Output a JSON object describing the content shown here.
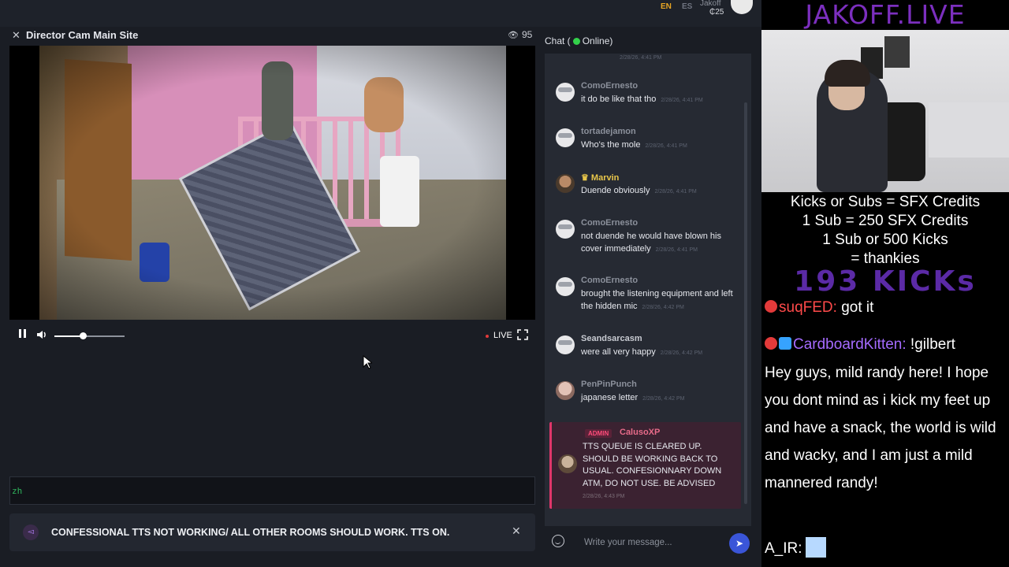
{
  "topbar": {
    "lang_en": "EN",
    "lang_es": "ES",
    "user_name": "Jakoff",
    "user_credits": "₵25"
  },
  "room": {
    "close_icon": "close-icon",
    "title": "Director Cam Main Site",
    "viewers": "95"
  },
  "player": {
    "volume_level": 0.4,
    "live_label": "LIVE"
  },
  "input_bar": {
    "hint": "zh"
  },
  "notice": {
    "text": "CONFESSIONAL TTS NOT WORKING/ ALL OTHER ROOMS SHOULD WORK. TTS ON."
  },
  "chat": {
    "header_prefix": "Chat (",
    "header_status": "Online)",
    "cut_timestamp": "2/28/26, 4:41 PM",
    "messages": [
      {
        "user": "ComoErnesto",
        "text": "it do be like that tho",
        "time": "2/28/26, 4:41 PM"
      },
      {
        "user": "tortadejamon",
        "text": "Who's the mole",
        "time": "2/28/26, 4:41 PM"
      },
      {
        "user": "Marvin",
        "text": "Duende obviously",
        "time": "2/28/26, 4:41 PM"
      },
      {
        "user": "ComoErnesto",
        "text": "not duende he would have blown his cover immediately",
        "time": "2/28/26, 4:41 PM"
      },
      {
        "user": "ComoErnesto",
        "text": "brought the listening equipment and left the hidden mic",
        "time": "2/28/26, 4:42 PM"
      },
      {
        "user": "Seandsarcasm",
        "text": "were all very happy",
        "time": "2/28/26, 4:42 PM"
      },
      {
        "user": "PenPinPunch",
        "text": "japanese letter",
        "time": "2/28/26, 4:42 PM"
      }
    ],
    "admin": {
      "badge": "ADMIN",
      "user": "CalusoXP",
      "text": "TTS QUEUE IS CLEARED UP. SHOULD BE WORKING BACK TO USUAL. CONFESIONNARY DOWN ATM, DO NOT USE. BE ADVISED",
      "time": "2/28/26, 4:43 PM"
    },
    "compose": {
      "placeholder": "Write your message...",
      "send_icon": "send-icon",
      "emoji_icon": "emoji-icon"
    }
  },
  "overlay": {
    "brand": "JAKOFF.LIVE",
    "line1": "Kicks or Subs = SFX Credits",
    "line2": "1 Sub = 250 SFX Credits",
    "line3": "1 Sub or 500 Kicks",
    "line4": "= thankies",
    "kicks_count": "193 KICKs",
    "chat1_user": "suqFED:",
    "chat1_text": " got it",
    "chat2_user": "CardboardKitten:",
    "chat2_text": " !gilbert",
    "tts_text": "Hey guys, mild randy here! I hope you dont mind as i kick my feet up and have a snack, the world is wild and wacky, and I am just a mild mannered randy!",
    "chat3_user": "A_IR:"
  }
}
